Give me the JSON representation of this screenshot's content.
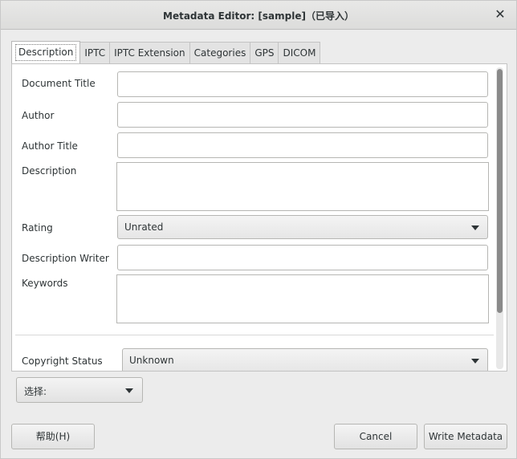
{
  "window": {
    "title": "Metadata Editor: [sample]（已导入）",
    "close_icon": "close-icon"
  },
  "tabs": [
    {
      "label": "Description",
      "active": true
    },
    {
      "label": "IPTC",
      "active": false
    },
    {
      "label": "IPTC Extension",
      "active": false
    },
    {
      "label": "Categories",
      "active": false
    },
    {
      "label": "GPS",
      "active": false
    },
    {
      "label": "DICOM",
      "active": false
    }
  ],
  "form": {
    "document_title": {
      "label": "Document Title",
      "value": ""
    },
    "author": {
      "label": "Author",
      "value": ""
    },
    "author_title": {
      "label": "Author Title",
      "value": ""
    },
    "description": {
      "label": "Description",
      "value": ""
    },
    "rating": {
      "label": "Rating",
      "value": "Unrated"
    },
    "description_writer": {
      "label": "Description Writer",
      "value": ""
    },
    "keywords": {
      "label": "Keywords",
      "value": ""
    },
    "copyright_status": {
      "label": "Copyright Status",
      "value": "Unknown"
    }
  },
  "select": {
    "label": "选择:"
  },
  "buttons": {
    "help": "帮助(H)",
    "cancel": "Cancel",
    "write": "Write Metadata"
  }
}
